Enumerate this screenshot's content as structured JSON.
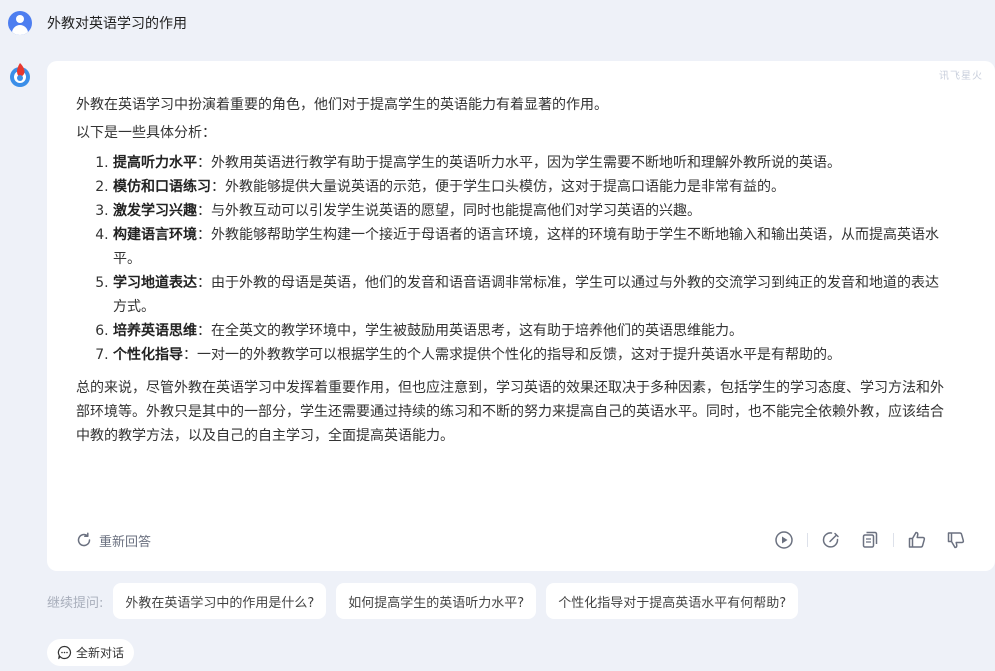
{
  "question": "外教对英语学习的作用",
  "brand": "讯飞星火",
  "answer": {
    "intro": "外教在英语学习中扮演着重要的角色，他们对于提高学生的英语能力有着显著的作用。",
    "lead": "以下是一些具体分析：",
    "points": [
      {
        "title": "提高听力水平",
        "text": "：外教用英语进行教学有助于提高学生的英语听力水平，因为学生需要不断地听和理解外教所说的英语。"
      },
      {
        "title": "模仿和口语练习",
        "text": "：外教能够提供大量说英语的示范，便于学生口头模仿，这对于提高口语能力是非常有益的。"
      },
      {
        "title": "激发学习兴趣",
        "text": "：与外教互动可以引发学生说英语的愿望，同时也能提高他们对学习英语的兴趣。"
      },
      {
        "title": "构建语言环境",
        "text": "：外教能够帮助学生构建一个接近于母语者的语言环境，这样的环境有助于学生不断地输入和输出英语，从而提高英语水平。"
      },
      {
        "title": "学习地道表达",
        "text": "：由于外教的母语是英语，他们的发音和语音语调非常标准，学生可以通过与外教的交流学习到纯正的发音和地道的表达方式。"
      },
      {
        "title": "培养英语思维",
        "text": "：在全英文的教学环境中，学生被鼓励用英语思考，这有助于培养他们的英语思维能力。"
      },
      {
        "title": "个性化指导",
        "text": "：一对一的外教教学可以根据学生的个人需求提供个性化的指导和反馈，这对于提升英语水平是有帮助的。"
      }
    ],
    "conclusion": "总的来说，尽管外教在英语学习中发挥着重要作用，但也应注意到，学习英语的效果还取决于多种因素，包括学生的学习态度、学习方法和外部环境等。外教只是其中的一部分，学生还需要通过持续的练习和不断的努力来提高自己的英语水平。同时，也不能完全依赖外教，应该结合中教的教学方法，以及自己的自主学习，全面提高英语能力。"
  },
  "actions": {
    "regenerate": "重新回答",
    "icons": [
      "play-icon",
      "edit-icon",
      "copy-icon",
      "thumbs-up-icon",
      "thumbs-down-icon"
    ]
  },
  "followups": {
    "label": "继续提问:",
    "items": [
      "外教在英语学习中的作用是什么?",
      "如何提高学生的英语听力水平?",
      "个性化指导对于提高英语水平有何帮助?"
    ]
  },
  "new_chat": "全新对话",
  "colors": {
    "background": "#eef1f8",
    "card": "#ffffff",
    "accent": "#4d7ef0",
    "icon": "#6b7180"
  }
}
